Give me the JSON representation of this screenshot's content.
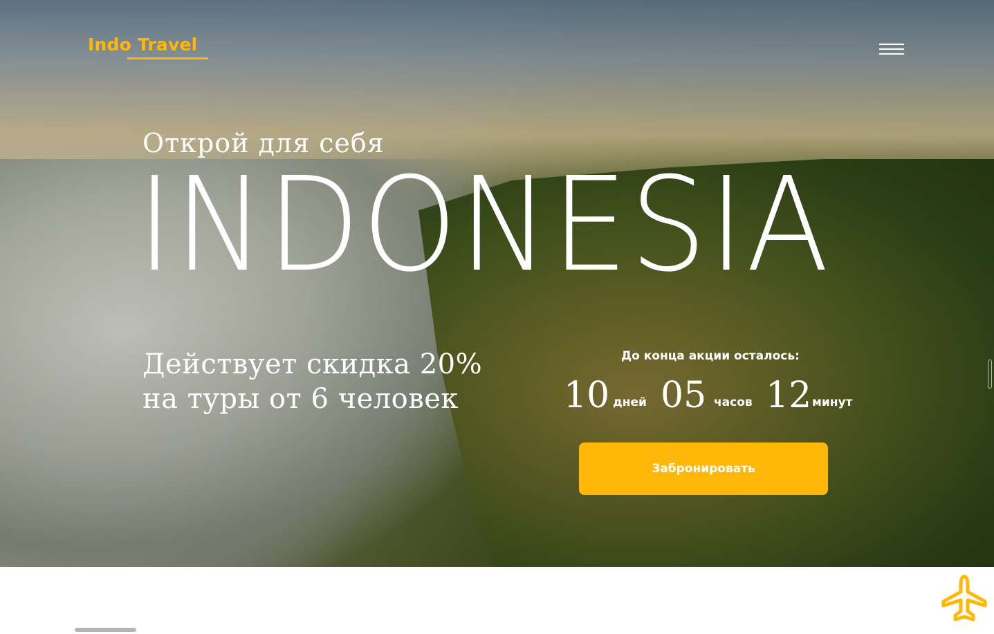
{
  "header": {
    "logo_text": "Indo Travel",
    "brand_color": "#ffb80a",
    "menu_icon": "hamburger-menu-icon"
  },
  "hero": {
    "subtitle": "Открой для себя",
    "title": "INDONESIA",
    "offer_line_1": "Действует скидка 20%",
    "offer_line_2": "на туры от 6 человек"
  },
  "countdown": {
    "label": "До конца акции осталось:",
    "days_value": "10",
    "days_unit": "дней",
    "hours_value": "05",
    "hours_unit": "часов",
    "minutes_value": "12",
    "minutes_unit": "минут"
  },
  "cta": {
    "book_label": "Забронировать"
  },
  "floating": {
    "plane_icon": "airplane-icon"
  }
}
